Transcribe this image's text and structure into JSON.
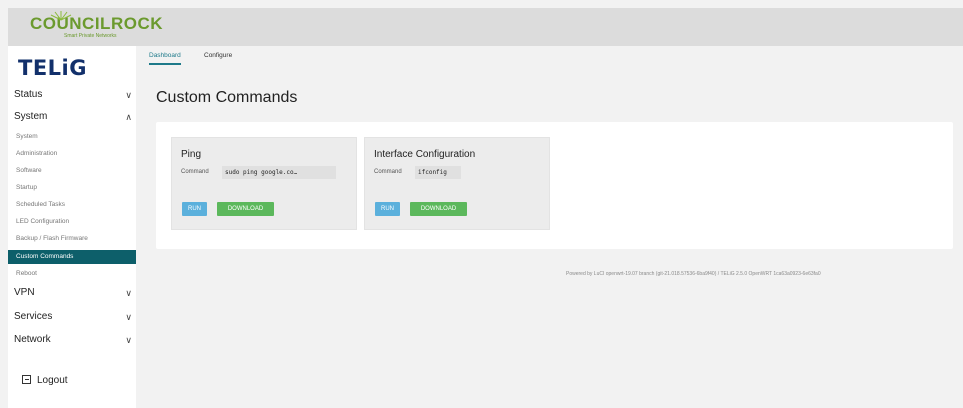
{
  "header": {
    "brand_name": "COUNCILROCK",
    "brand_tagline": "Smart Private Networks"
  },
  "sidebar": {
    "logo": "TELiG",
    "groups": [
      {
        "label": "Status",
        "chevron": "chevron-down-icon"
      },
      {
        "label": "System",
        "chevron": "chevron-up-icon"
      },
      {
        "label": "VPN",
        "chevron": "chevron-down-icon"
      },
      {
        "label": "Services",
        "chevron": "chevron-down-icon"
      },
      {
        "label": "Network",
        "chevron": "chevron-down-icon"
      }
    ],
    "system_items": [
      "System",
      "Administration",
      "Software",
      "Startup",
      "Scheduled Tasks",
      "LED Configuration",
      "Backup / Flash Firmware",
      "Custom Commands",
      "Reboot"
    ],
    "logout": "Logout"
  },
  "tabs": [
    {
      "label": "Dashboard",
      "active": true
    },
    {
      "label": "Configure",
      "active": false
    }
  ],
  "page_title": "Custom Commands",
  "commands": [
    {
      "title": "Ping",
      "command_label": "Command",
      "command": "sudo ping google.co…",
      "run": "RUN",
      "download": "DOWNLOAD"
    },
    {
      "title": "Interface Configuration",
      "command_label": "Command",
      "command": "ifconfig",
      "run": "RUN",
      "download": "DOWNLOAD"
    }
  ],
  "footer": "Powered by LuCI openwrt-19.07 branch (git-21.018.57536-6ba9f40) / TELiG 2.5.0 OpenWRT 1ca63a0923-6e63fa0",
  "colors": {
    "active_nav": "#0d5f6a",
    "run_button": "#5bb0dc",
    "download_button": "#5cb85c",
    "brand_green": "#6b9a2e",
    "logo_navy": "#12306b"
  }
}
